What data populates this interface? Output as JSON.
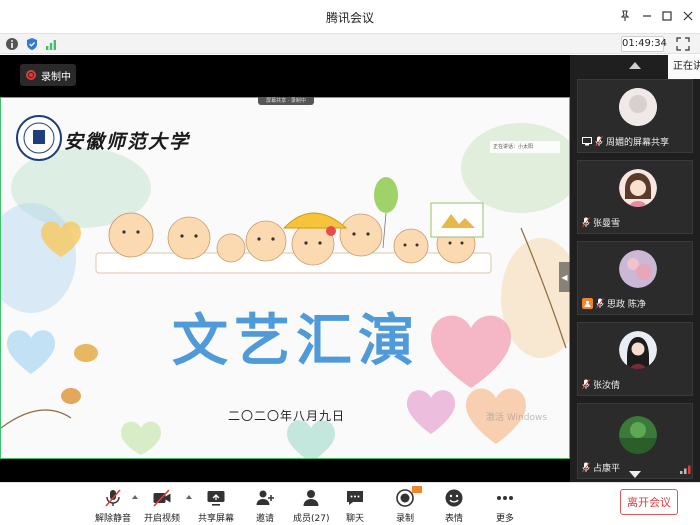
{
  "window": {
    "title": "腾讯会议"
  },
  "infobar": {
    "timer": "01:49:34"
  },
  "main": {
    "recording_badge": "录制中",
    "slide": {
      "university": "安徽师范大学",
      "title": "文艺汇演",
      "date": "二〇二〇年八月九日",
      "speaker_tag": "正在讲话：小太阳",
      "share_strip": "屏幕共享 · 录制中",
      "watermark": "激活 Windows"
    }
  },
  "sidebar": {
    "status_tooltip": "正在讲",
    "participants": [
      {
        "name": "周媚的屏幕共享",
        "sharing": true
      },
      {
        "name": "张曼雪"
      },
      {
        "name": "思政 陈净",
        "host": true
      },
      {
        "name": "张汝倩"
      },
      {
        "name": "占康平"
      }
    ]
  },
  "toolbar": {
    "unmute": "解除静音",
    "start_video": "开启视频",
    "share_screen": "共享屏幕",
    "invite": "邀请",
    "members": "成员(27)",
    "chat": "聊天",
    "record": "录制",
    "reactions": "表情",
    "more": "更多",
    "leave": "离开会议"
  },
  "colors": {
    "accent_green": "#3cc36a",
    "leave_red": "#e03e3e",
    "record_red": "#e53935",
    "slide_title_blue": "#4f9ad8"
  }
}
